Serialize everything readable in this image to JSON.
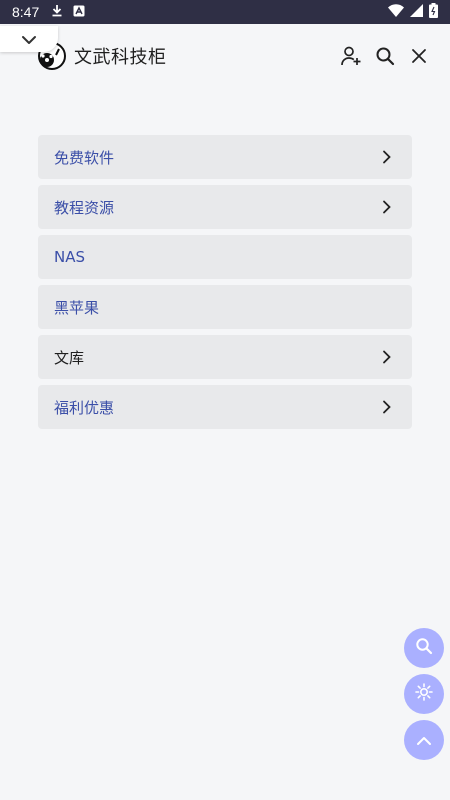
{
  "status_bar": {
    "time": "8:47"
  },
  "header": {
    "title": "文武科技柜"
  },
  "menu": {
    "items": [
      {
        "label": "免费软件",
        "has_arrow": true
      },
      {
        "label": "教程资源",
        "has_arrow": true
      },
      {
        "label": "NAS",
        "has_arrow": false
      },
      {
        "label": "黑苹果",
        "has_arrow": false
      },
      {
        "label": "文库",
        "has_arrow": true
      },
      {
        "label": "福利优惠",
        "has_arrow": true
      }
    ]
  },
  "colors": {
    "status_bar_bg": "#2f2f45",
    "page_bg": "#f5f6f8",
    "menu_item_bg": "#e8e9eb",
    "link_blue": "#3b4fa8",
    "fab_bg": "#aab0ff"
  },
  "icons": {
    "header": [
      "add-user-icon",
      "search-icon",
      "close-icon"
    ],
    "fabs": [
      "search-icon",
      "brightness-icon",
      "chevron-up-icon"
    ]
  }
}
